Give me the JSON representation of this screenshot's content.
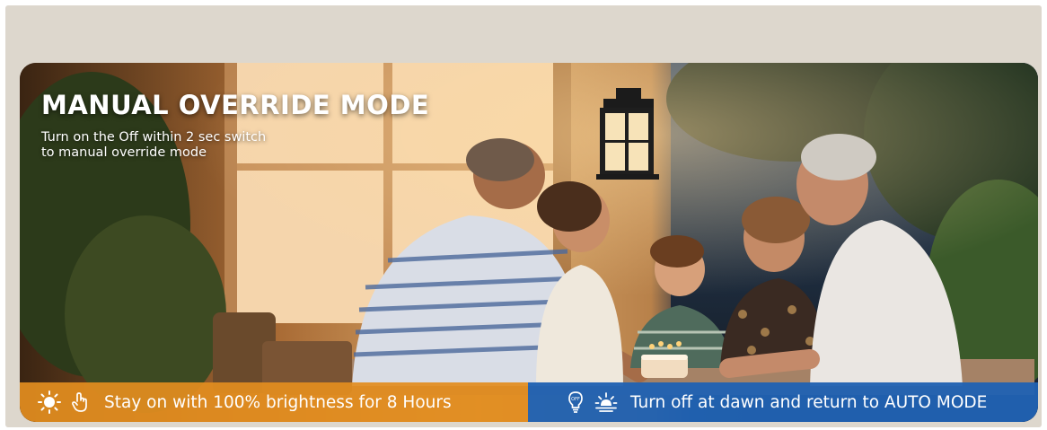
{
  "banner": {
    "headline": "MANUAL OVERRIDE MODE",
    "subtext_line1": "Turn on the Off within 2 sec switch",
    "subtext_line2": "to manual override mode"
  },
  "features": {
    "left": {
      "icons": [
        "sun-icon",
        "tap-hand-icon"
      ],
      "label": "Stay on with 100% brightness for 8 Hours",
      "color": "#E28D1F"
    },
    "right": {
      "icons": [
        "lightbulb-off-icon",
        "sunrise-icon"
      ],
      "label": "Turn off at dawn and return to AUTO MODE",
      "color": "#2062B2"
    }
  },
  "photo": {
    "subject": "family dinner-icon"
  }
}
